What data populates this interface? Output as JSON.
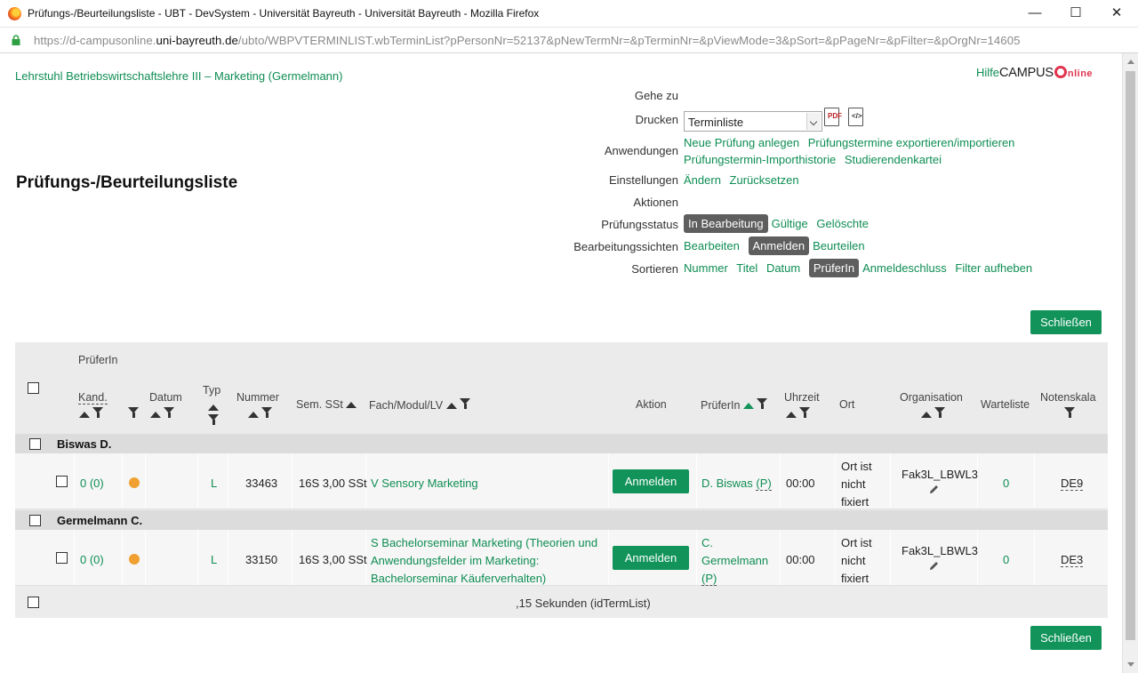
{
  "window": {
    "title": "Prüfungs-/Beurteilungsliste - UBT - DevSystem - Universität Bayreuth - Universität Bayreuth - Mozilla Firefox",
    "minimize": "—",
    "maximize": "☐",
    "close": "✕"
  },
  "url": {
    "prefix": "https://d-campusonline.",
    "domain": "uni-bayreuth.de",
    "path": "/ubto/WBPVTERMINLIST.wbTerminList?pPersonNr=52137&pNewTermNr=&pTerminNr=&pViewMode=3&pSort=&pPageNr=&pFilter=&pOrgNr=14605"
  },
  "header": {
    "org": "Lehrstuhl Betriebswirtschaftslehre III – Marketing (Germelmann)",
    "help": "Hilfe",
    "brand": "CAMPUS",
    "brand_line": "nline"
  },
  "page_title": "Prüfungs-/Beurteilungsliste",
  "controls": {
    "gehe_zu": "Gehe zu",
    "drucken": "Drucken",
    "drucken_select": "Terminliste",
    "pdf_icon_text": "PDF",
    "xml_icon_text": "</>",
    "anwendungen": "Anwendungen",
    "anw_links": [
      "Neue Prüfung anlegen",
      "Prüfungstermine exportieren/importieren",
      "Prüfungstermin-Importhistorie",
      "Studierendenkartei"
    ],
    "einstellungen": "Einstellungen",
    "einst_links": [
      "Ändern",
      "Zurücksetzen"
    ],
    "aktionen": "Aktionen",
    "pruefungsstatus": "Prüfungsstatus",
    "status_active": "In Bearbeitung",
    "status_links": [
      "Gültige",
      "Gelöschte"
    ],
    "sichten": "Bearbeitungssichten",
    "sichten_pre": "Bearbeiten",
    "sichten_active": "Anmelden",
    "sichten_post": "Beurteilen",
    "sortieren": "Sortieren",
    "sort_pre": [
      "Nummer",
      "Titel",
      "Datum"
    ],
    "sort_active": "PrüferIn",
    "sort_post": [
      "Anmeldeschluss",
      "Filter aufheben"
    ]
  },
  "buttons": {
    "close": "Schließen"
  },
  "table": {
    "headers": {
      "prueferin_top": "PrüferIn",
      "kand": "Kand.",
      "datum": "Datum",
      "typ": "Typ",
      "nummer": "Nummer",
      "sem": "Sem. SSt",
      "fach": "Fach/Modul/LV",
      "aktion": "Aktion",
      "prueferin": "PrüferIn",
      "uhrzeit": "Uhrzeit",
      "ort": "Ort",
      "organisation": "Organisation",
      "warteliste": "Warteliste",
      "notenskala": "Notenskala"
    },
    "groups": [
      {
        "name": "Biswas D.",
        "row": {
          "kand": "0 (0)",
          "typ": "L",
          "nummer": "33463",
          "sem": "16S 3,00 SSt",
          "fach": [
            "V Sensory Marketing"
          ],
          "aktion": "Anmelden",
          "prueferin": [
            "D. Biswas ",
            "(P)"
          ],
          "uhrzeit": "00:00",
          "ort": [
            "Ort ist",
            "nicht",
            "fixiert"
          ],
          "organisation": "Fak3L_LBWL3",
          "warteliste": "0",
          "notenskala": "DE9"
        }
      },
      {
        "name": "Germelmann C.",
        "row": {
          "kand": "0 (0)",
          "typ": "L",
          "nummer": "33150",
          "sem": "16S 3,00 SSt",
          "fach": [
            "S Bachelorseminar Marketing (Theorien und",
            "Anwendungsfelder im Marketing:",
            "Bachelorseminar Käuferverhalten)"
          ],
          "aktion": "Anmelden",
          "prueferin": [
            "C.",
            "Germelmann",
            "(P)"
          ],
          "uhrzeit": "00:00",
          "ort": [
            "Ort ist",
            "nicht",
            "fixiert"
          ],
          "organisation": "Fak3L_LBWL3",
          "warteliste": "0",
          "notenskala": "DE3"
        }
      }
    ],
    "footer": ",15 Sekunden (idTermList)"
  }
}
